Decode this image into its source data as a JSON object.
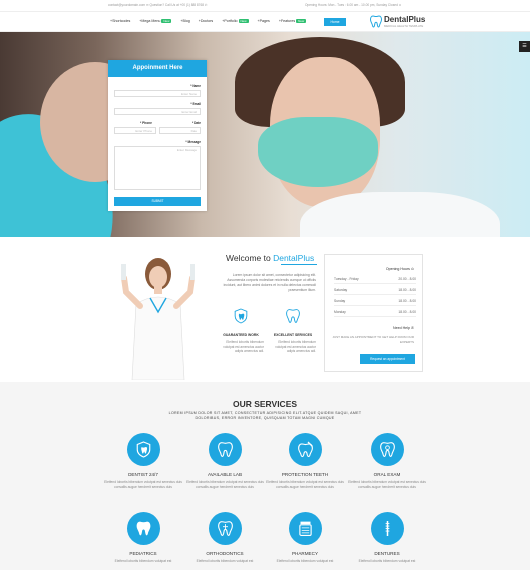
{
  "topbar": {
    "left": "contact@yourdomain.com  ✉  Question? Call Us at +00 (1) 888 8768 ✆",
    "right": "Opening Hours: Mon - Tues : 6.00 am - 10.00 pm, Sunday Closed ⊙"
  },
  "nav": {
    "items": [
      {
        "label": "Shortcodes",
        "badge": ""
      },
      {
        "label": "Mega Menu",
        "badge": "New"
      },
      {
        "label": "Blog",
        "badge": ""
      },
      {
        "label": "Doctors",
        "badge": ""
      },
      {
        "label": "Portfolio",
        "badge": "New"
      },
      {
        "label": "Pages",
        "badge": ""
      },
      {
        "label": "Features",
        "badge": "New"
      }
    ],
    "cta": "Home"
  },
  "logo": {
    "name": "DentalPlus",
    "tagline": "MEDICAL HEALTH TEMPLATE"
  },
  "side_icon": "☰",
  "appointment": {
    "title": "Appoinment Here",
    "name_label": "* Name",
    "name_placeholder": "Enter Name",
    "email_label": "* Email",
    "email_placeholder": "Enter Email",
    "phone_label": "* Phone",
    "phone_placeholder": "Enter Phone",
    "date_label": "* Date",
    "date_placeholder": "Date",
    "message_label": "* Message",
    "message_placeholder": "Enter Message",
    "submit": "SUBMIT"
  },
  "welcome": {
    "title_prefix": "Welcome to ",
    "title_highlight": "DentalPlus",
    "text": "Lorem ipsum dolor sit amet, consectetur adipisicing elit. Assumenda corporis molestiae reiciendis cumque ut officiis incidunt, aut libero animi dolores et in nulla delectus commodi praesentium illum.",
    "features": [
      {
        "title": "GUARANTEED WORK",
        "desc": "Eleifend lobortis bibendum volutpat est amenctus auctor adipis amenctus adi."
      },
      {
        "title": "EXCELLENT SERVICES",
        "desc": "Eleifend lobortis bibendum volutpat est amenctus auctor adipis amenctus adi."
      }
    ]
  },
  "hours": {
    "title": "Opening Hours ⊙",
    "rows": [
      {
        "day": "Tuesday - Friday",
        "time": "20.00 - 8.00"
      },
      {
        "day": "Saturday",
        "time": "18.00 - 8.00"
      },
      {
        "day": "Sunday",
        "time": "18.00 - 8.00"
      },
      {
        "day": "Monday",
        "time": "18.00 - 8.00"
      }
    ],
    "help": "Need Help ✆",
    "note": "JUST MAKE AN APPOINTMENT TO GET HELP FROM OUR EXPERTS",
    "button": "Request an appointment"
  },
  "services": {
    "title": "OUR SERVICES",
    "subtitle": "LOREM IPSUM DOLOR SIT AMET, CONSECTETUR ADIPISICING ELIT.ATQUE QUIDEM SAQUI, AMET DOLORIBUS, ERROR INVENTORE, QUISQUAM TOTAM MAGNI CUMQUE",
    "items": [
      {
        "name": "Dentist 24/7",
        "icon": "tooth-shield-icon",
        "desc": "Eleifend lobortis bibendum volutpat est senectus duis convallis augue hendrerit senectus duis"
      },
      {
        "name": "Available lab",
        "icon": "tooth-icon",
        "desc": "Eleifend lobortis bibendum volutpat est senectus duis convallis augue hendrerit senectus duis"
      },
      {
        "name": "Protection teeth",
        "icon": "tooth-brush-icon",
        "desc": "Eleifend lobortis bibendum volutpat est senectus duis convallis augue hendrerit senectus duis"
      },
      {
        "name": "Oral exam",
        "icon": "tooth-search-icon",
        "desc": "Eleifend lobortis bibendum volutpat est senectus duis convallis augue hendrerit senectus duis"
      },
      {
        "name": "Pediatrics",
        "icon": "tooth-smile-icon",
        "desc": "Eleifend lobortis bibendum volutpat est"
      },
      {
        "name": "Orthodontics",
        "icon": "tooth-sparkle-icon",
        "desc": "Eleifend lobortis bibendum volutpat est"
      },
      {
        "name": "Pharmecy",
        "icon": "pill-jar-icon",
        "desc": "Eleifend lobortis bibendum volutpat est"
      },
      {
        "name": "Dentures",
        "icon": "dental-tool-icon",
        "desc": "Eleifend lobortis bibendum volutpat est"
      }
    ]
  },
  "colors": {
    "accent": "#1fa6e0",
    "badge": "#2fbf71"
  }
}
